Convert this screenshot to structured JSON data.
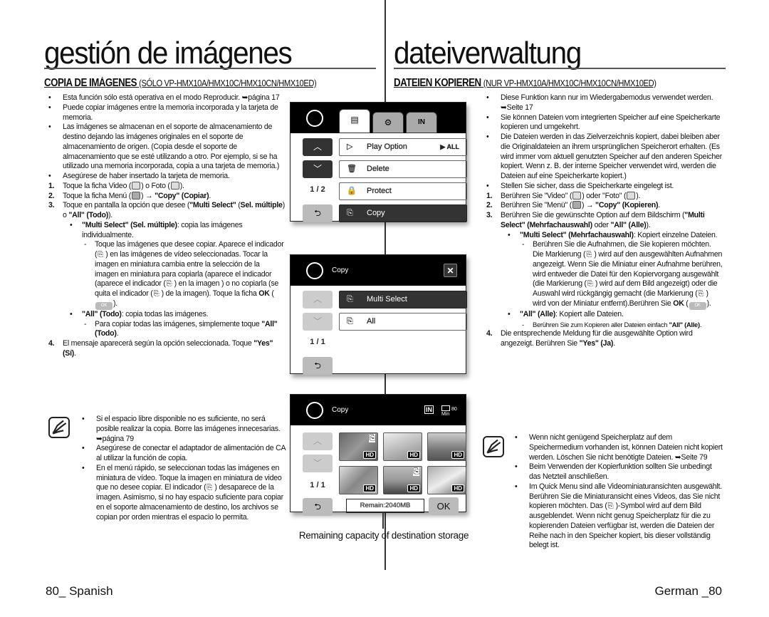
{
  "left": {
    "title": "gestión de imágenes",
    "subtitle_main": "COPIA DE IMÁGENES",
    "subtitle_models": "(SÓLO VP-HMX10A/HMX10C/HMX10CN/HMX10ED)",
    "items": [
      {
        "type": "bullet",
        "mk": "•",
        "parts": [
          {
            "t": "Esta función sólo está operativa en el modo Reproducir. ➥página 17"
          }
        ]
      },
      {
        "type": "bullet",
        "mk": "•",
        "parts": [
          {
            "t": "Puede copiar imágenes entre la memoria incorporada y la tarjeta de memoria."
          }
        ]
      },
      {
        "type": "bullet",
        "mk": "•",
        "parts": [
          {
            "t": "Las imágenes se almacenan en el soporte de almacenamiento de destino  dejando las imágenes originales en el soporte de almacenamiento de origen. (Copia desde el soporte de almacenamiento que se esté utilizando a otro. Por ejemplo, si se ha utilizado una memoria incorporada, copia a una tarjeta de memoria.)"
          }
        ]
      },
      {
        "type": "bullet",
        "mk": "•",
        "parts": [
          {
            "t": "Asegúrese de haber insertado la tarjeta de memoria."
          }
        ]
      },
      {
        "type": "num",
        "mk": "1.",
        "parts": [
          {
            "t": "Toque la ficha Video ("
          },
          {
            "icon": "video-icon"
          },
          {
            "t": ") o Foto ("
          },
          {
            "icon": "photo-icon"
          },
          {
            "t": ")."
          }
        ]
      },
      {
        "type": "num",
        "mk": "2.",
        "parts": [
          {
            "t": "Toque la ficha Menú ("
          },
          {
            "icon": "menu-icon"
          },
          {
            "t": ") → "
          },
          {
            "t": "\"Copy\" (Copiar)",
            "b": true
          },
          {
            "t": "."
          }
        ]
      },
      {
        "type": "num",
        "mk": "3.",
        "parts": [
          {
            "t": "Toque en pantalla la opción que desee ("
          },
          {
            "t": "\"Multi Select\"",
            "b": true
          },
          {
            "t": " ("
          },
          {
            "t": "Sel. múltiple",
            "b": true
          },
          {
            "t": ") o "
          },
          {
            "t": "\"All\" (Todo)",
            "b": true
          },
          {
            "t": ")."
          }
        ]
      },
      {
        "type": "sb",
        "mk": "•",
        "parts": [
          {
            "t": "\"Multi Select\" (Sel. múltiple)",
            "b": true
          },
          {
            "t": ": copia las imágenes individualmente."
          }
        ]
      },
      {
        "type": "ds",
        "mk": "-",
        "parts": [
          {
            "t": "Toque las imágenes que desee copiar. Aparece el indicador ("
          },
          {
            "icon": "copy-indicator-icon"
          },
          {
            "t": ")  en las imágenes de vídeo seleccionadas. Tocar la imagen en miniatura cambia entre la selección de la imagen en miniatura para copiarla (aparece el indicador (aparece el indicador ("
          },
          {
            "icon": "copy-indicator-icon"
          },
          {
            "t": ") en la imagen ) o no copiarla (se quita el indicador ("
          },
          {
            "icon": "copy-indicator-icon"
          },
          {
            "t": ") de la imagen). Toque la ficha "
          },
          {
            "t": "OK",
            "b": true
          },
          {
            "t": " ("
          },
          {
            "icon": "ok-button-icon"
          },
          {
            "t": ")."
          }
        ]
      },
      {
        "type": "sb",
        "mk": "•",
        "parts": [
          {
            "t": "\"All\" (Todo)",
            "b": true
          },
          {
            "t": ": copia todas las imágenes."
          }
        ]
      },
      {
        "type": "ds",
        "mk": "-",
        "parts": [
          {
            "t": "Para copiar todas las imágenes, simplemente toque "
          },
          {
            "t": "\"All\" (Todo)",
            "b": true
          },
          {
            "t": "."
          }
        ]
      },
      {
        "type": "num",
        "mk": "4.",
        "parts": [
          {
            "t": "El mensaje aparecerá según la opción seleccionada. Toque "
          },
          {
            "t": "\"Yes\" (Sí)",
            "b": true
          },
          {
            "t": "."
          }
        ]
      }
    ],
    "notes": [
      {
        "type": "bullet",
        "mk": "•",
        "parts": [
          {
            "t": "Si el espacio libre disponible no es suficiente, no será posible realizar la copia. Borre las imágenes innecesarias. ➥página 79"
          }
        ]
      },
      {
        "type": "bullet",
        "mk": "•",
        "parts": [
          {
            "t": "Asegúrese de conectar el adaptador de alimentación de CA al utilizar la función de copia."
          }
        ]
      },
      {
        "type": "bullet",
        "mk": "•",
        "parts": [
          {
            "t": "En el menú rápido, se seleccionan todas las imágenes en miniatura de vídeo. Toque la imagen en miniatura de video que no desee copiar. El indicador ("
          },
          {
            "icon": "copy-indicator-icon"
          },
          {
            "t": ") desaparece de la imagen. Asimismo, si no hay espacio suficiente para copiar en el soporte almacenamiento de destino, los archivos se copian por orden mientras el espacio lo permita."
          }
        ]
      }
    ],
    "footer": "80_ Spanish"
  },
  "right": {
    "title": "dateiverwaltung",
    "subtitle_main": "DATEIEN KOPIEREN",
    "subtitle_models": "(NUR VP-HMX10A/HMX10C/HMX10CN/HMX10ED)",
    "items": [
      {
        "type": "bullet",
        "mk": "•",
        "parts": [
          {
            "t": "Diese Funktion kann nur im Wiedergabemodus verwendet werden. ➥Seite 17"
          }
        ]
      },
      {
        "type": "bullet",
        "mk": "•",
        "parts": [
          {
            "t": "Sie können Dateien vom integrierten Speicher auf eine Speicherkarte kopieren und umgekehrt."
          }
        ]
      },
      {
        "type": "bullet",
        "mk": "•",
        "parts": [
          {
            "t": "Die Dateien werden in das Zielverzeichnis kopiert, dabei bleiben aber die Originaldateien an ihrem ursprünglichen Speicherort erhalten. (Es wird immer vom aktuell genutzten Speicher auf den anderen Speicher kopiert. Wenn z. B. der interne Speicher verwendet wird, werden die Dateien auf eine Speicherkarte kopiert.)"
          }
        ]
      },
      {
        "type": "bullet",
        "mk": "•",
        "parts": [
          {
            "t": "Stellen Sie sicher, dass die Speicherkarte eingelegt ist."
          }
        ]
      },
      {
        "type": "num",
        "mk": "1.",
        "parts": [
          {
            "t": "Berühren Sie \"Video\" ("
          },
          {
            "icon": "video-icon"
          },
          {
            "t": ") oder \"Foto\" ("
          },
          {
            "icon": "photo-icon"
          },
          {
            "t": ")."
          }
        ]
      },
      {
        "type": "num",
        "mk": "2.",
        "parts": [
          {
            "t": "Berühren Sie \"Menü\" ("
          },
          {
            "icon": "menu-icon"
          },
          {
            "t": ") → "
          },
          {
            "t": "\"Copy\" (Kopieren)",
            "b": true
          },
          {
            "t": "."
          }
        ]
      },
      {
        "type": "num",
        "mk": "3.",
        "parts": [
          {
            "t": "Berühren Sie die gewünschte Option auf dem Bildschirm ("
          },
          {
            "t": "\"Multi Select\" (Mehrfachauswahl)",
            "b": true
          },
          {
            "t": " oder "
          },
          {
            "t": "\"All\" (Alle)",
            "b": true
          },
          {
            "t": ")."
          }
        ]
      },
      {
        "type": "sb",
        "mk": "•",
        "parts": [
          {
            "t": "\"Multi Select\" (Mehrfachauswahl)",
            "b": true
          },
          {
            "t": ": Kopiert einzelne Dateien."
          }
        ]
      },
      {
        "type": "ds",
        "mk": "-",
        "parts": [
          {
            "t": "Berühren Sie die Aufnahmen, die Sie kopieren möchten. Die Markierung ("
          },
          {
            "icon": "copy-indicator-icon"
          },
          {
            "t": ")  wird auf den ausgewählten Aufnahmen angezeigt. Wenn Sie die Miniatur einer Aufnahme berühren, wird entweder die Datei für den Kopiervorgang ausgewählt (die Markierung ("
          },
          {
            "icon": "copy-indicator-icon"
          },
          {
            "t": ") wird auf dem Bild angezeigt) oder die Auswahl wird rückgängig gemacht (die Markierung ("
          },
          {
            "icon": "copy-indicator-icon"
          },
          {
            "t": ") wird von der Miniatur entfernt).Berühren Sie "
          },
          {
            "t": "OK",
            "b": true
          },
          {
            "t": " ("
          },
          {
            "icon": "ok-button-icon"
          },
          {
            "t": ")."
          }
        ]
      },
      {
        "type": "sb",
        "mk": "•",
        "parts": [
          {
            "t": "\"All\" (Alle)",
            "b": true
          },
          {
            "t": ": Kopiert alle Dateien."
          }
        ]
      },
      {
        "type": "ds small",
        "mk": "-",
        "parts": [
          {
            "t": "Berühren Sie zum Kopieren aller Dateien einfach "
          },
          {
            "t": "\"All\" (Alle)",
            "b": true
          },
          {
            "t": "."
          }
        ]
      },
      {
        "type": "num",
        "mk": "4.",
        "parts": [
          {
            "t": "Die entsprechende Meldung für die ausgewählte Option wird angezeigt. Berühren Sie "
          },
          {
            "t": "\"Yes\" (Ja)",
            "b": true
          },
          {
            "t": "."
          }
        ]
      }
    ],
    "notes": [
      {
        "type": "bullet",
        "mk": "•",
        "parts": [
          {
            "t": "Wenn nicht genügend Speicherplatz auf dem Speichermedium vorhanden ist, können Dateien nicht kopiert werden. Löschen Sie nicht benötigte Dateien. ➥Seite 79"
          }
        ]
      },
      {
        "type": "bullet",
        "mk": "•",
        "parts": [
          {
            "t": "Beim Verwenden der Kopierfunktion sollten Sie unbedingt das Netzteil anschließen."
          }
        ]
      },
      {
        "type": "bullet",
        "mk": "•",
        "parts": [
          {
            "t": "Im Quick Menu sind alle Videominiaturansichten ausgewählt. Berühren Sie die Miniaturansicht eines Videos, das Sie nicht kopieren möchten. Das ("
          },
          {
            "icon": "copy-indicator-icon"
          },
          {
            "t": ")-Symbol wird auf dem Bild ausgeblendet. Wenn nicht genug Speicherplatz für die zu kopierenden Dateien verfügbar ist, werden die Dateien der Reihe nach in den Speicher kopiert, bis dieser vollständig belegt ist."
          }
        ]
      }
    ],
    "footer": "German _80"
  },
  "screen1": {
    "tabs": [
      {
        "icon": "menu-icon",
        "glyph": "▤"
      },
      {
        "icon": "gear-icon",
        "glyph": "⚙"
      },
      {
        "icon": "internal-memory-icon",
        "glyph": "IN"
      }
    ],
    "page": "1 / 2",
    "items": [
      {
        "label": "Play Option",
        "icon": "play-option-icon",
        "glyph": "▷",
        "extra": "▶ ALL"
      },
      {
        "label": "Delete",
        "icon": "trash-icon",
        "glyph": "🗑"
      },
      {
        "label": "Protect",
        "icon": "lock-icon",
        "glyph": "🔒"
      },
      {
        "label": "Copy",
        "icon": "copy-icon",
        "glyph": "⎘",
        "selected": true
      }
    ]
  },
  "screen2": {
    "header": "Copy",
    "page": "1 / 1",
    "items": [
      {
        "label": "Multi Select",
        "icon": "multi-select-icon",
        "glyph": "⎘",
        "selected": true
      },
      {
        "label": "All",
        "icon": "select-all-icon",
        "glyph": "⎘"
      }
    ]
  },
  "screen3": {
    "header": "Copy",
    "storage": "IN",
    "battery": "80 Min",
    "page": "1 / 1",
    "thumbs": [
      {
        "hd": "HD",
        "copy": true
      },
      {
        "hd": "HD",
        "copy": false
      },
      {
        "hd": "HD",
        "copy": false
      },
      {
        "hd": "HD",
        "copy": false
      },
      {
        "hd": "HD",
        "copy": true
      },
      {
        "hd": "HD",
        "copy": false
      }
    ],
    "remain": "Remain:2040MB",
    "ok": "OK"
  },
  "caption": "Remaining capacity of destination storage"
}
